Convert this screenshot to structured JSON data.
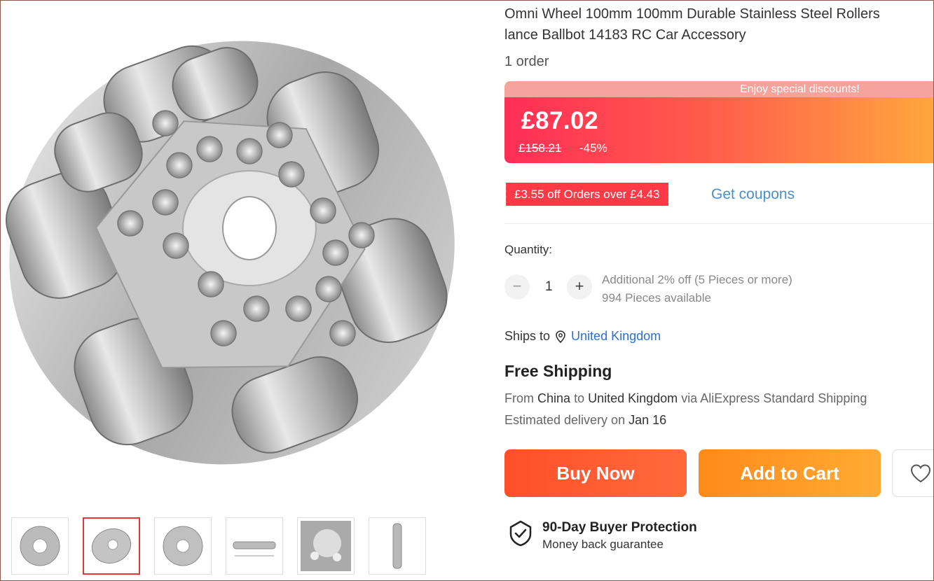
{
  "product": {
    "title_line1": "Omni Wheel 100mm 100mm Durable Stainless Steel Rollers",
    "title_line2": "lance Ballbot 14183 RC Car Accessory",
    "orders": "1 order"
  },
  "promo": {
    "banner": "Enjoy special discounts!",
    "price": "£87.02",
    "old_price": "£158.21",
    "discount": "-45%"
  },
  "coupon": {
    "text": "£3.55 off Orders over £4.43",
    "link": "Get coupons"
  },
  "quantity": {
    "label": "Quantity:",
    "minus": "−",
    "value": "1",
    "plus": "+",
    "bulk_offer": "Additional 2% off (5 Pieces or more)",
    "available": "994 Pieces available"
  },
  "shipping": {
    "ships_to_label": "Ships to",
    "country": "United Kingdom",
    "free_shipping": "Free Shipping",
    "from_text": "From",
    "origin": "China",
    "to_text": "to",
    "destination": "United Kingdom",
    "via_text": "via AliExpress Standard Shipping",
    "estimated_label": "Estimated delivery on",
    "estimated_date": "Jan 16"
  },
  "actions": {
    "buy_now": "Buy Now",
    "add_to_cart": "Add to Cart"
  },
  "protection": {
    "title": "90-Day Buyer Protection",
    "subtitle": "Money back guarantee"
  },
  "gallery": {
    "selected_index": 1,
    "thumbnail_count": 6
  },
  "colors": {
    "price_gradient_start": "#ff2e56",
    "price_gradient_end": "#ffa83d",
    "coupon_red": "#ff3a46",
    "link_blue": "#4a90c8",
    "buy_now": "#ff5533",
    "add_to_cart": "#ff9a28"
  }
}
